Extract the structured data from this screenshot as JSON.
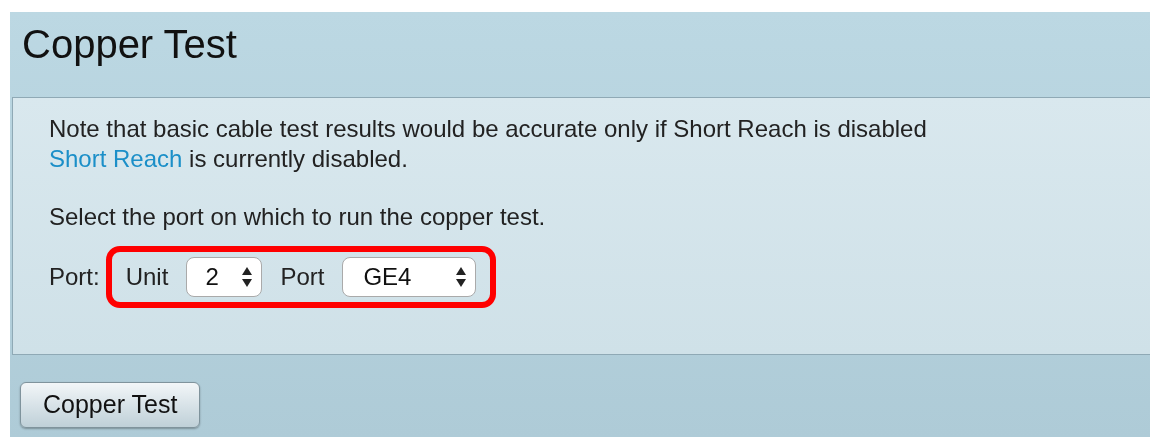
{
  "page_title": "Copper Test",
  "note": {
    "line_1": "Note that basic cable test results would be accurate only if Short Reach is disabled",
    "line_2_link": "Short Reach",
    "line_2_rest": " is currently disabled."
  },
  "instruction": "Select the port on which to run the copper test.",
  "port_row": {
    "label": "Port:",
    "highlighted": true,
    "selects": [
      {
        "label": "Unit",
        "value": "2"
      },
      {
        "label": "Port",
        "value": "GE4"
      }
    ]
  },
  "buttons": [
    {
      "label": "Copper Test"
    }
  ]
}
